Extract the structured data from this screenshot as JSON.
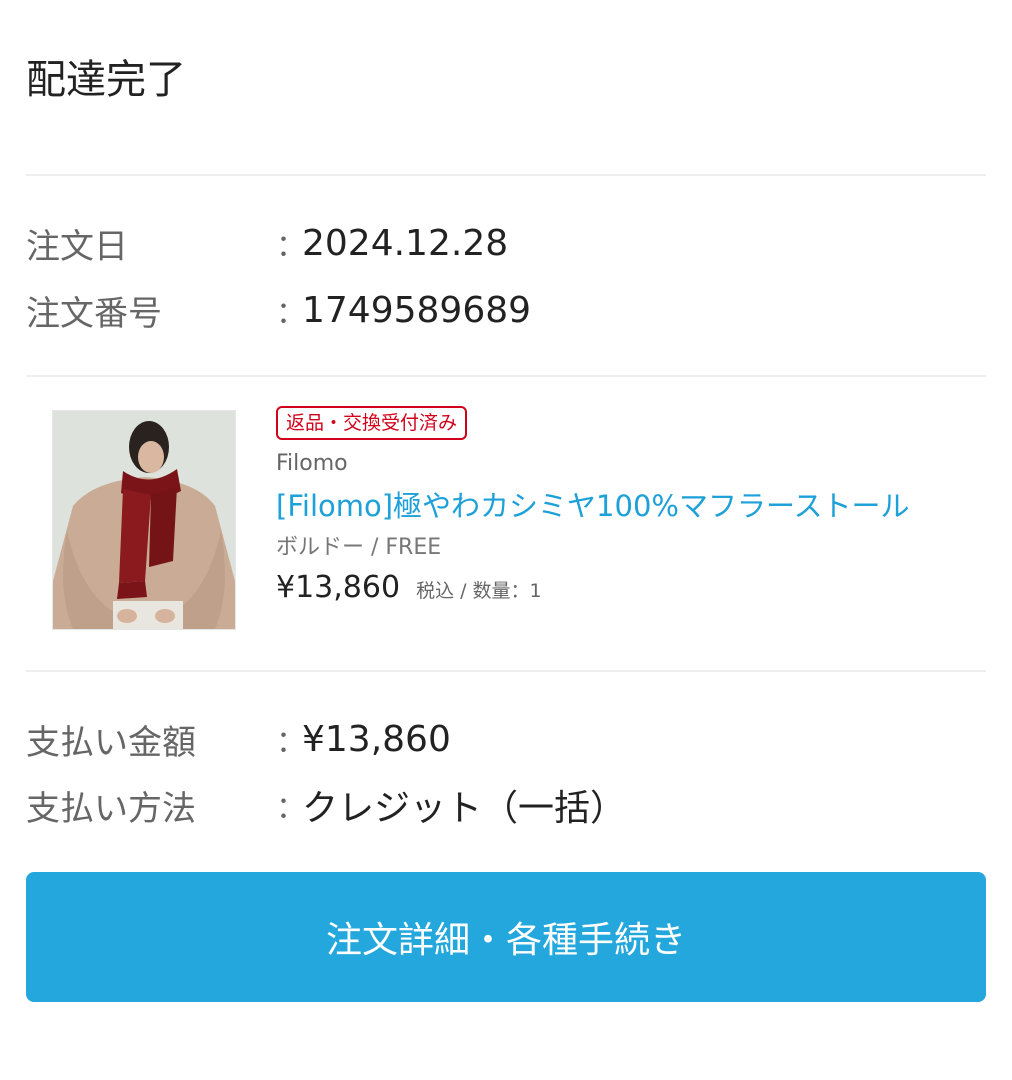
{
  "status_title": "配達完了",
  "order_info": {
    "order_date_label": "注文日",
    "order_date_value": "2024.12.28",
    "order_number_label": "注文番号",
    "order_number_value": "1749589689",
    "colon": "："
  },
  "product": {
    "badge": "返品・交換受付済み",
    "brand": "Filomo",
    "name": "[Filomo]極やわカシミヤ100%マフラーストール",
    "variant": "ボルドー / FREE",
    "price": "¥13,860",
    "tax_quantity": "税込 / 数量：1",
    "image_icon": "product-photo-scarf"
  },
  "payment": {
    "amount_label": "支払い金額",
    "amount_value": "¥13,860",
    "method_label": "支払い方法",
    "method_value": "クレジット（一括）"
  },
  "cta": {
    "label": "注文詳細・各種手続き"
  },
  "colors": {
    "accent": "#24a7dc",
    "link": "#1ea0d8",
    "badge": "#d0021b"
  }
}
